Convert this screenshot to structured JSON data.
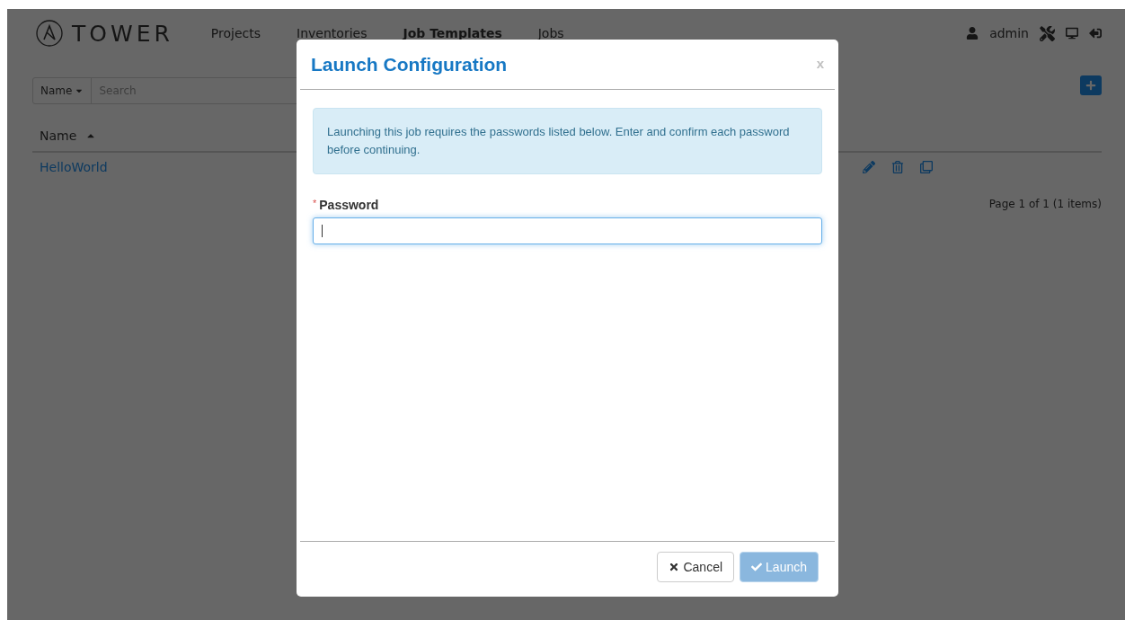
{
  "nav": {
    "logo": "TOWER",
    "items": [
      {
        "label": "Projects",
        "selected": false
      },
      {
        "label": "Inventories",
        "selected": false
      },
      {
        "label": "Job Templates",
        "selected": true
      },
      {
        "label": "Jobs",
        "selected": false
      }
    ],
    "user": "admin"
  },
  "search": {
    "field": "Name",
    "placeholder": "Search"
  },
  "table": {
    "columns": [
      {
        "label": "Name"
      }
    ],
    "rows": [
      {
        "name": "HelloWorld"
      }
    ]
  },
  "pagination": "Page 1 of 1 (1 items)",
  "modal": {
    "title": "Launch Configuration",
    "close": "x",
    "alert": "Launching this job requires the passwords listed below. Enter and confirm each password before continuing.",
    "fields": [
      {
        "label": "Password",
        "required_mark": "*",
        "focused": true
      }
    ],
    "buttons": [
      {
        "kind": "cancel",
        "label": "Cancel",
        "disabled": false
      },
      {
        "kind": "launch",
        "label": "Launch",
        "disabled": true
      }
    ]
  }
}
